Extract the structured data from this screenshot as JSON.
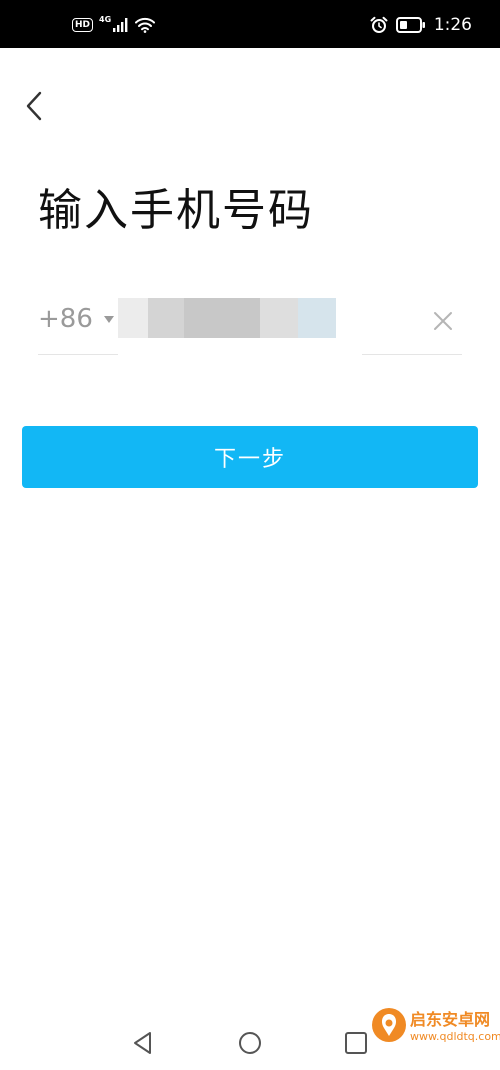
{
  "status_bar": {
    "hd_label": "HD",
    "network_label": "4G",
    "time": "1:26"
  },
  "page": {
    "title": "输入手机号码"
  },
  "phone": {
    "country_code": "+86",
    "value": "",
    "placeholder": ""
  },
  "actions": {
    "next_label": "下一步"
  },
  "watermark": {
    "title": "启东安卓网",
    "url": "www.qdldtq.com"
  },
  "colors": {
    "status_bar_bg": "#000000",
    "primary_button": "#12b7f5",
    "title_text": "#111111",
    "muted_text": "#9a9a9a",
    "watermark": "#f08a24"
  },
  "icons": {
    "status_left": [
      "hd-badge-icon",
      "signal-icon",
      "wifi-icon"
    ],
    "status_right": [
      "alarm-icon",
      "battery-icon"
    ],
    "header": [
      "chevron-left-icon"
    ],
    "phone": [
      "triangle-down-icon",
      "close-icon"
    ],
    "nav": [
      "nav-back-icon",
      "nav-home-icon",
      "nav-recent-icon"
    ]
  }
}
